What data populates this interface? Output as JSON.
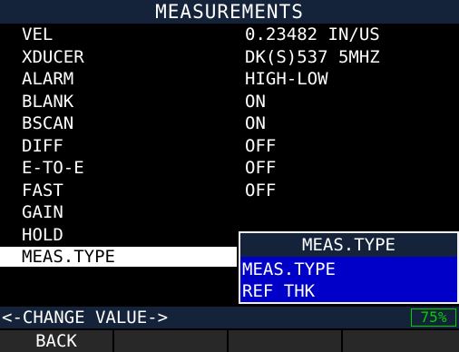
{
  "title": "MEASUREMENTS",
  "rows": [
    {
      "label": "VEL",
      "value": "0.23482  IN/US"
    },
    {
      "label": "XDUCER",
      "value": "DK(S)537  5MHZ"
    },
    {
      "label": "ALARM",
      "value": "HIGH-LOW"
    },
    {
      "label": "BLANK",
      "value": "ON"
    },
    {
      "label": "BSCAN",
      "value": "ON"
    },
    {
      "label": "DIFF",
      "value": "OFF"
    },
    {
      "label": "E-TO-E",
      "value": "OFF"
    },
    {
      "label": "FAST",
      "value": "OFF"
    },
    {
      "label": "GAIN",
      "value": ""
    },
    {
      "label": "HOLD",
      "value": ""
    },
    {
      "label": "MEAS.TYPE",
      "value": ""
    }
  ],
  "selected_row": "MEAS.TYPE",
  "dropdown": {
    "header": "MEAS.TYPE",
    "options": [
      "MEAS.TYPE",
      "REF THK"
    ]
  },
  "status": {
    "hint": "<-CHANGE VALUE->",
    "battery": "75%"
  },
  "softkeys": [
    "BACK",
    "",
    "",
    ""
  ],
  "colors": {
    "title_bar": "#14233a",
    "dropdown_bg": "#0000c8",
    "battery": "#00d000"
  }
}
